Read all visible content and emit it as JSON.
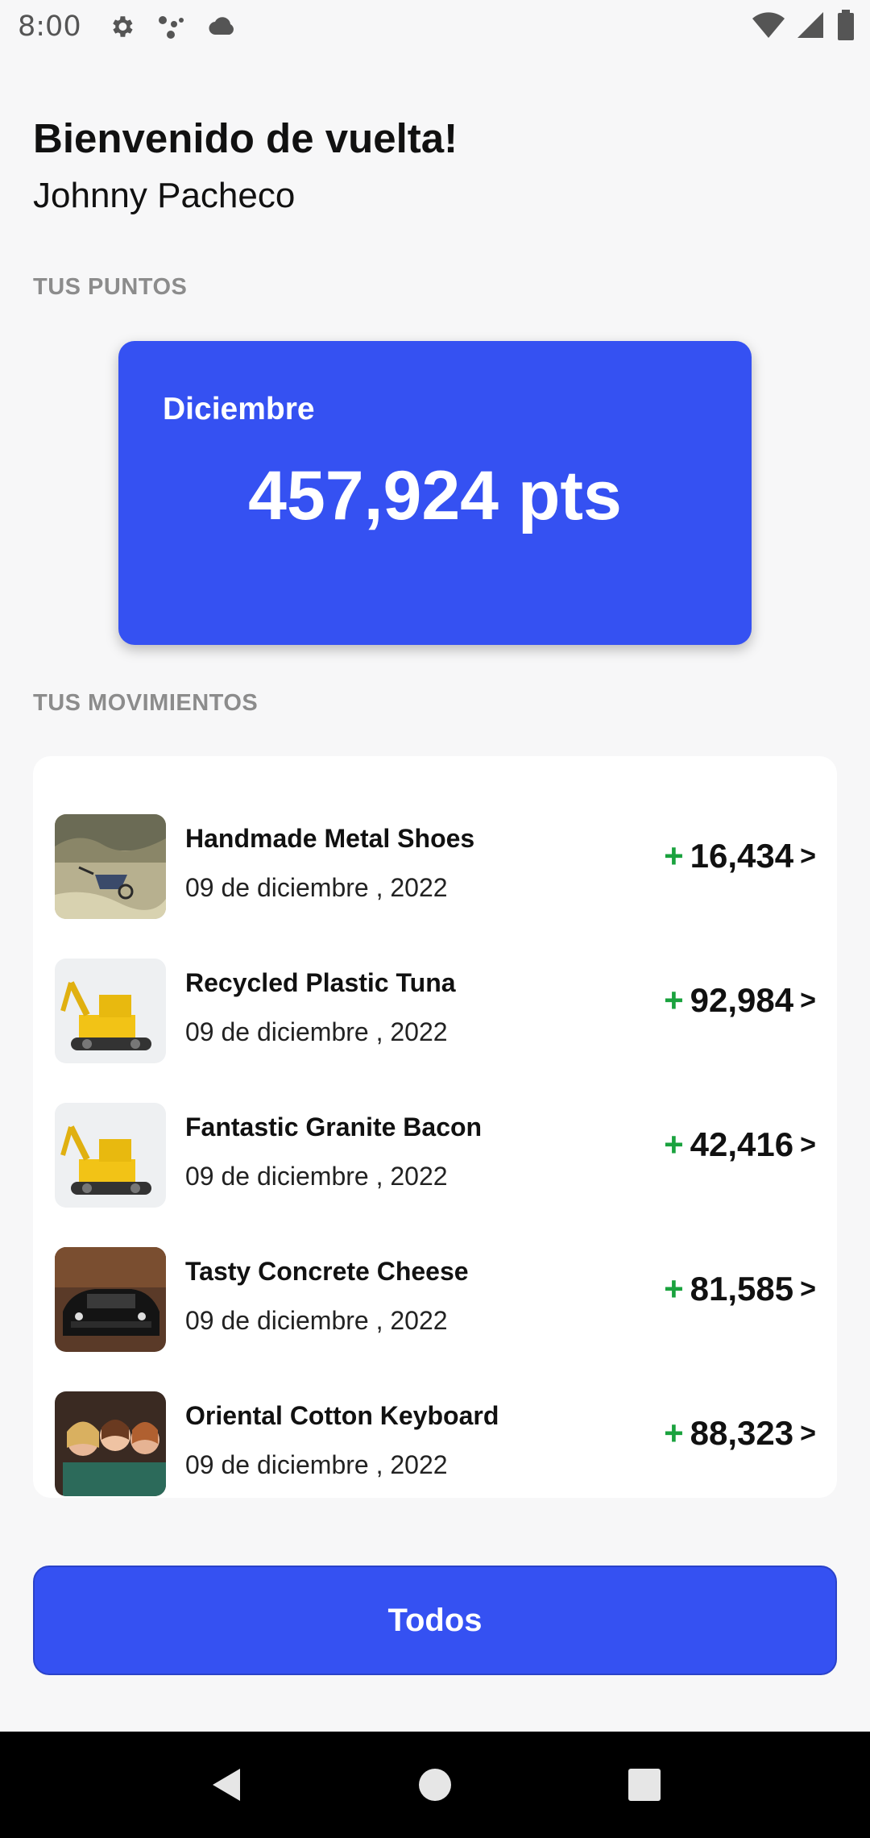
{
  "status_bar": {
    "time": "8:00",
    "icons_left": [
      "gear-icon",
      "assistant-dots-icon",
      "cloud-icon"
    ],
    "icons_right": [
      "wifi-icon",
      "signal-icon",
      "battery-icon"
    ]
  },
  "header": {
    "greeting": "Bienvenido de vuelta!",
    "username": "Johnny Pacheco"
  },
  "points": {
    "section_label": "TUS PUNTOS",
    "month": "Diciembre",
    "value": "457,924 pts",
    "card_color": "#3551f2"
  },
  "movements": {
    "section_label": "TUS MOVIMIENTOS",
    "items": [
      {
        "title": "Handmade Metal Shoes",
        "date": "09 de diciembre , 2022",
        "sign": "+",
        "amount": "16,434",
        "chevron": ">",
        "image": "wheelbarrow-photo"
      },
      {
        "title": "Recycled Plastic Tuna",
        "date": "09 de diciembre , 2022",
        "sign": "+",
        "amount": "92,984",
        "chevron": ">",
        "image": "toy-excavator-photo"
      },
      {
        "title": "Fantastic Granite Bacon",
        "date": "09 de diciembre , 2022",
        "sign": "+",
        "amount": "42,416",
        "chevron": ">",
        "image": "toy-excavator-photo"
      },
      {
        "title": "Tasty Concrete Cheese",
        "date": "09 de diciembre , 2022",
        "sign": "+",
        "amount": "81,585",
        "chevron": ">",
        "image": "car-photo"
      },
      {
        "title": "Oriental Cotton Keyboard",
        "date": "09 de diciembre , 2022",
        "sign": "+",
        "amount": "88,323",
        "chevron": ">",
        "image": "group-photo"
      }
    ]
  },
  "actions": {
    "all_label": "Todos"
  },
  "nav": {
    "icons": [
      "back-icon",
      "home-icon",
      "recents-icon"
    ]
  },
  "colors": {
    "accent": "#3551f2",
    "positive": "#1aa23e",
    "label_gray": "#8c8c8c"
  }
}
